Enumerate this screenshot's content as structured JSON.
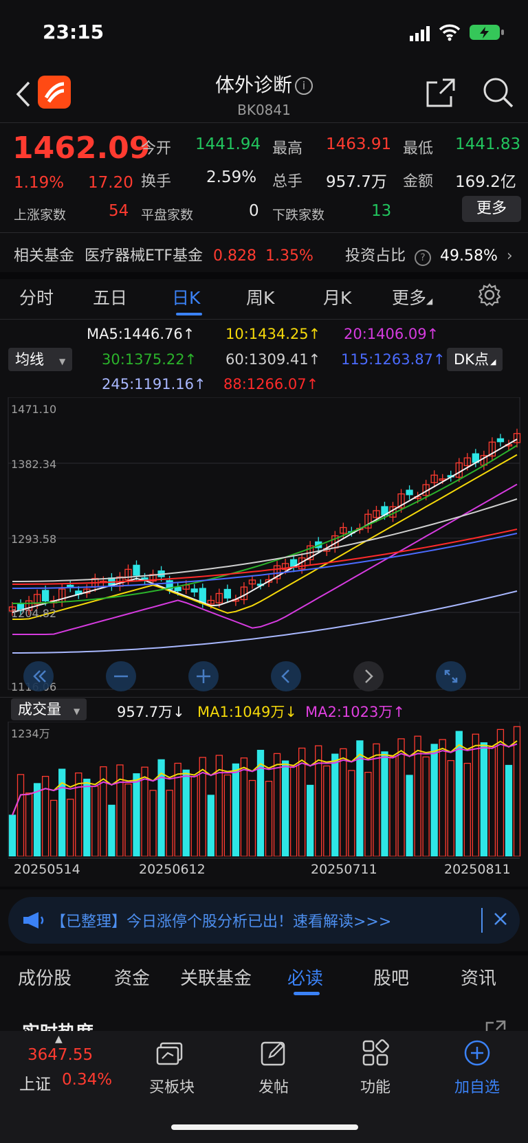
{
  "status": {
    "time": "23:15"
  },
  "header": {
    "title": "体外诊断",
    "code": "BK0841"
  },
  "quote": {
    "price": "1462.09",
    "change_pct": "1.19%",
    "change": "17.20",
    "open_label": "今开",
    "open": "1441.94",
    "high_label": "最高",
    "high": "1463.91",
    "low_label": "最低",
    "low": "1441.83",
    "turnover_label": "换手",
    "turnover": "2.59%",
    "volume_label": "总手",
    "volume": "957.7万",
    "amount_label": "金额",
    "amount": "169.2亿",
    "up_label": "上涨家数",
    "up": "54",
    "flat_label": "平盘家数",
    "flat": "0",
    "down_label": "下跌家数",
    "down": "13",
    "more_label": "更多"
  },
  "fund": {
    "label": "相关基金",
    "name": "医疗器械ETF基金",
    "price": "0.828",
    "pct": "1.35%",
    "ratio_label": "投资占比",
    "ratio": "49.58%"
  },
  "tabs": [
    "分时",
    "五日",
    "日K",
    "周K",
    "月K",
    "更多"
  ],
  "active_tab": "日K",
  "ma": {
    "selector": "均线",
    "dk_label": "DK点",
    "ma5": "MA5:1446.76↑",
    "ma10": "10:1434.25↑",
    "ma20": "20:1406.09↑",
    "ma30": "30:1375.22↑",
    "ma60": "60:1309.41↑",
    "ma115": "115:1263.87↑",
    "ma245": "245:1191.16↑",
    "ma88": "88:1266.07↑"
  },
  "price_axis": [
    "1471.10",
    "1382.34",
    "1293.58",
    "1204.82",
    "1116.06"
  ],
  "volume": {
    "selector": "成交量",
    "vol": "957.7万↓",
    "ma1": "MA1:1049万↓",
    "ma2": "MA2:1023万↑",
    "axis_max": "1234万"
  },
  "dates": [
    "20250514",
    "20250612",
    "20250711",
    "20250811"
  ],
  "banner": {
    "text": "【已整理】今日涨停个股分析已出！速看解读>>>"
  },
  "bottom_tabs": [
    "成份股",
    "资金",
    "关联基金",
    "必读",
    "股吧",
    "资讯"
  ],
  "active_bottom_tab": "必读",
  "section_title": "实时热度",
  "index": {
    "price": "3647.55",
    "name": "上证",
    "pct": "0.34%"
  },
  "bottom_nav": [
    "买板块",
    "发帖",
    "功能",
    "加自选"
  ],
  "colors": {
    "up": "#ff3b30",
    "down": "#22c55e",
    "accent": "#3b82f6",
    "volume_down": "#2ee6e6"
  }
}
